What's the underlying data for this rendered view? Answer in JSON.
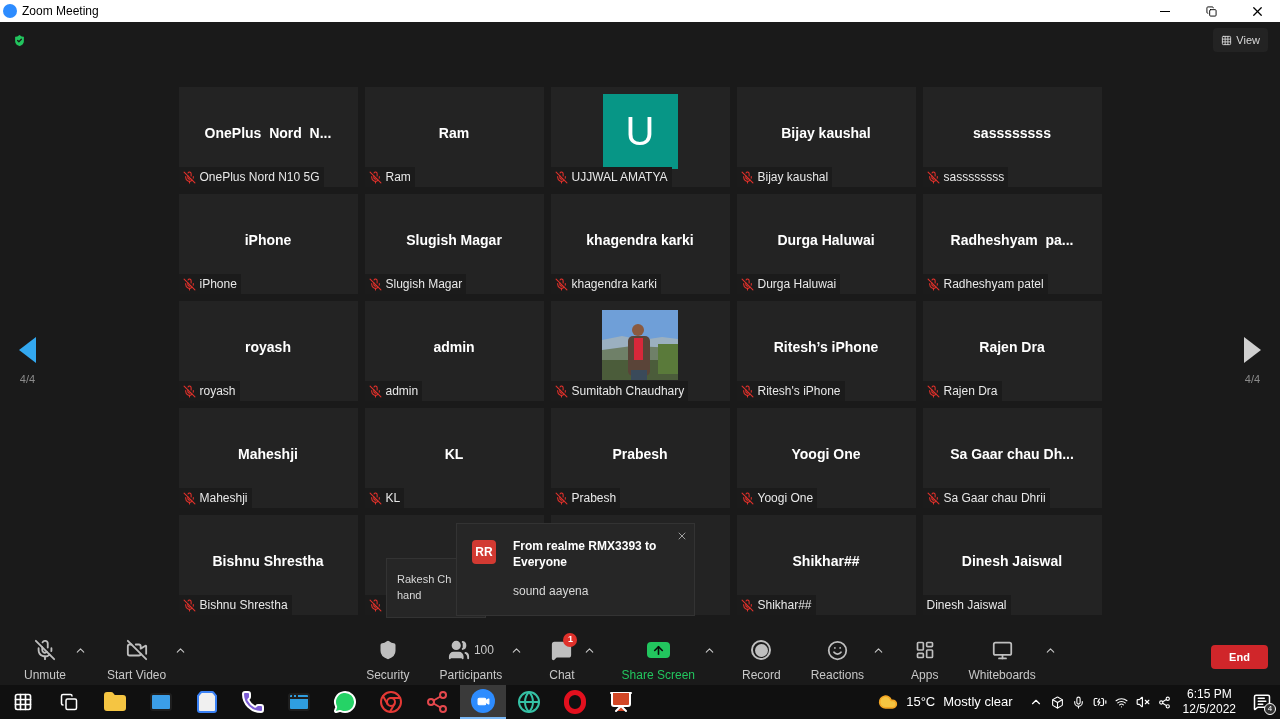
{
  "window": {
    "title": "Zoom Meeting"
  },
  "top_bar": {
    "view_button": "View"
  },
  "pager": {
    "left": "4/4",
    "right": "4/4"
  },
  "tiles": [
    {
      "kind": "name",
      "display": "OnePlus  Nord  N...",
      "label": "OnePlus Nord N10 5G",
      "muted": true
    },
    {
      "kind": "name",
      "display": "Ram",
      "label": "Ram",
      "muted": true
    },
    {
      "kind": "avatar",
      "display": "U",
      "label": "UJJWAL AMATYA",
      "muted": true
    },
    {
      "kind": "name",
      "display": "Bijay kaushal",
      "label": "Bijay kaushal",
      "muted": true
    },
    {
      "kind": "name",
      "display": "sassssssss",
      "label": "sassssssss",
      "muted": true
    },
    {
      "kind": "name",
      "display": "iPhone",
      "label": "iPhone",
      "muted": true
    },
    {
      "kind": "name",
      "display": "Slugish Magar",
      "label": "Slugish Magar",
      "muted": true
    },
    {
      "kind": "name",
      "display": "khagendra karki",
      "label": "khagendra karki",
      "muted": true
    },
    {
      "kind": "name",
      "display": "Durga Haluwai",
      "label": "Durga Haluwai",
      "muted": true
    },
    {
      "kind": "name",
      "display": "Radheshyam  pa...",
      "label": "Radheshyam patel",
      "muted": true
    },
    {
      "kind": "name",
      "display": "royash",
      "label": "royash",
      "muted": true
    },
    {
      "kind": "name",
      "display": "admin",
      "label": "admin",
      "muted": true
    },
    {
      "label": "Sumitabh Chaudhary",
      "muted": true
    },
    {
      "kind": "name",
      "display": "Ritesh’s iPhone",
      "label": "Ritesh's iPhone",
      "muted": true
    },
    {
      "kind": "name",
      "display": "Rajen Dra",
      "label": "Rajen Dra",
      "muted": true
    },
    {
      "kind": "name",
      "display": "Maheshji",
      "label": "Maheshji",
      "muted": true
    },
    {
      "kind": "name",
      "display": "KL",
      "label": "KL",
      "muted": true
    },
    {
      "kind": "name",
      "display": "Prabesh",
      "label": "Prabesh",
      "muted": true
    },
    {
      "kind": "name",
      "display": "Yoogi One",
      "label": "Yoogi One",
      "muted": true
    },
    {
      "kind": "name",
      "display": "Sa Gaar chau Dh...",
      "label": "Sa Gaar chau Dhrii",
      "muted": true
    },
    {
      "kind": "name",
      "display": "Bishnu Shrestha",
      "label": "Bishnu Shrestha",
      "muted": true
    },
    {
      "kind": "blank",
      "muted": true
    },
    {
      "kind": "blank",
      "muted": false
    },
    {
      "kind": "name",
      "display": "Shikhar##",
      "label": "Shikhar##",
      "muted": true
    },
    {
      "kind": "name",
      "display": "Dinesh Jaiswal",
      "label": "Dinesh Jaiswal",
      "muted": false
    }
  ],
  "raise_hand_tip": {
    "lines": [
      "Rakesh Ch",
      "hand"
    ]
  },
  "chat_popup": {
    "avatar": "RR",
    "title": "From realme RMX3393 to Everyone",
    "message": "sound aayena"
  },
  "toolbar": {
    "items": [
      {
        "kind": "unmute",
        "label": "Unmute",
        "has_menu": true
      },
      {
        "kind": "video",
        "label": "Start Video",
        "has_menu": true
      },
      {
        "kind": "security",
        "label": "Security",
        "has_menu": false
      },
      {
        "kind": "participants",
        "label": "Participants",
        "count": "100",
        "has_menu": true
      },
      {
        "kind": "chat",
        "label": "Chat",
        "badge": "1",
        "has_menu": true
      },
      {
        "kind": "share",
        "label": "Share Screen",
        "has_menu": true
      },
      {
        "kind": "record",
        "label": "Record",
        "has_menu": false
      },
      {
        "kind": "reactions",
        "label": "Reactions",
        "has_menu": true
      },
      {
        "kind": "apps",
        "label": "Apps",
        "has_menu": false
      },
      {
        "kind": "whiteboards",
        "label": "Whiteboards",
        "has_menu": true
      }
    ],
    "end_button": "End"
  },
  "taskbar": {
    "apps": [
      {
        "kind": "start",
        "active": false
      },
      {
        "kind": "taskview",
        "active": false
      },
      {
        "kind": "folder",
        "active": false
      },
      {
        "kind": "mail",
        "active": false
      },
      {
        "kind": "store",
        "active": false
      },
      {
        "kind": "viber",
        "active": false
      },
      {
        "kind": "window",
        "active": false
      },
      {
        "kind": "whatsapp",
        "active": false
      },
      {
        "kind": "chrome",
        "active": false
      },
      {
        "kind": "nodes",
        "active": false
      },
      {
        "kind": "zoom",
        "active": true
      },
      {
        "kind": "edge",
        "active": false
      },
      {
        "kind": "opera",
        "active": false
      },
      {
        "kind": "powerpoint",
        "active": false
      }
    ],
    "weather": {
      "temp": "15°C",
      "text": "Mostly clear"
    },
    "time": "6:15 PM",
    "date": "12/5/2022",
    "notifications": "4"
  }
}
